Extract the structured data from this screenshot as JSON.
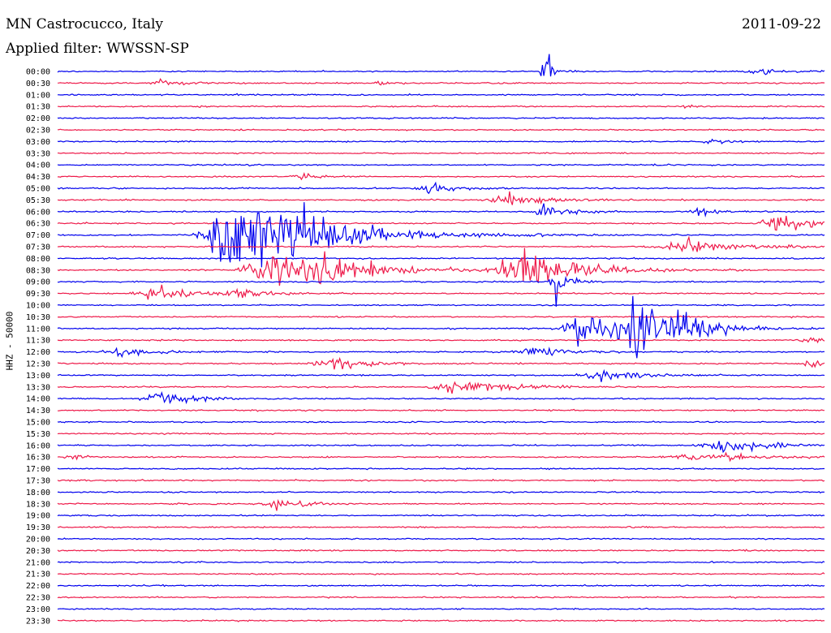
{
  "header": {
    "station": "MN Castrocucco, Italy",
    "date": "2011-09-22",
    "filter": "Applied filter: WWSSN-SP"
  },
  "chart_data": {
    "type": "line",
    "ylabel": "HHZ - 50000",
    "colors": [
      "#0000ee",
      "#ee1a4a"
    ],
    "rows": [
      "00:00",
      "00:30",
      "01:00",
      "01:30",
      "02:00",
      "02:30",
      "03:00",
      "03:30",
      "04:00",
      "04:30",
      "05:00",
      "05:30",
      "06:00",
      "06:30",
      "07:00",
      "07:30",
      "08:00",
      "08:30",
      "09:00",
      "09:30",
      "10:00",
      "10:30",
      "11:00",
      "11:30",
      "12:00",
      "12:30",
      "13:00",
      "13:30",
      "14:00",
      "14:30",
      "15:00",
      "15:30",
      "16:00",
      "16:30",
      "17:00",
      "17:30",
      "18:00",
      "18:30",
      "19:00",
      "19:30",
      "20:00",
      "20:30",
      "21:00",
      "21:30",
      "22:00",
      "22:30",
      "23:00",
      "23:30"
    ],
    "events": [
      {
        "row": 0,
        "minute": 19.0,
        "amplitude": 20,
        "duration": 0.5
      },
      {
        "row": 0,
        "minute": 27.5,
        "amplitude": 3,
        "duration": 2
      },
      {
        "row": 1,
        "minute": 4.0,
        "amplitude": 7,
        "duration": 1
      },
      {
        "row": 1,
        "minute": 12.5,
        "amplitude": 4,
        "duration": 0.6
      },
      {
        "row": 3,
        "minute": 24.5,
        "amplitude": 2,
        "duration": 0.5
      },
      {
        "row": 6,
        "minute": 25.5,
        "amplitude": 3,
        "duration": 0.8
      },
      {
        "row": 9,
        "minute": 9.5,
        "amplitude": 4,
        "duration": 1
      },
      {
        "row": 10,
        "minute": 14.5,
        "amplitude": 7,
        "duration": 1.5
      },
      {
        "row": 11,
        "minute": 17.5,
        "amplitude": 8,
        "duration": 2
      },
      {
        "row": 12,
        "minute": 19.0,
        "amplitude": 7,
        "duration": 1.5
      },
      {
        "row": 12,
        "minute": 25.0,
        "amplitude": 10,
        "duration": 0.8
      },
      {
        "row": 13,
        "minute": 28.0,
        "amplitude": 10,
        "duration": 2
      },
      {
        "row": 14,
        "minute": 6.5,
        "amplitude": 50,
        "duration": 3
      },
      {
        "row": 14,
        "minute": 9.0,
        "amplitude": 20,
        "duration": 5
      },
      {
        "row": 15,
        "minute": 24.5,
        "amplitude": 8,
        "duration": 3
      },
      {
        "row": 17,
        "minute": 8.5,
        "amplitude": 30,
        "duration": 4
      },
      {
        "row": 17,
        "minute": 18.0,
        "amplitude": 30,
        "duration": 3
      },
      {
        "row": 18,
        "minute": 19.5,
        "amplitude": 20,
        "duration": 0.7
      },
      {
        "row": 19,
        "minute": 3.5,
        "amplitude": 10,
        "duration": 2
      },
      {
        "row": 19,
        "minute": 7.0,
        "amplitude": 7,
        "duration": 1.5
      },
      {
        "row": 22,
        "minute": 20.5,
        "amplitude": 18,
        "duration": 3
      },
      {
        "row": 22,
        "minute": 22.5,
        "amplitude": 40,
        "duration": 1.5
      },
      {
        "row": 22,
        "minute": 24.5,
        "amplitude": 14,
        "duration": 2
      },
      {
        "row": 23,
        "minute": 29.3,
        "amplitude": 5,
        "duration": 1
      },
      {
        "row": 24,
        "minute": 2.5,
        "amplitude": 5,
        "duration": 2
      },
      {
        "row": 24,
        "minute": 18.5,
        "amplitude": 6,
        "duration": 2
      },
      {
        "row": 25,
        "minute": 10.5,
        "amplitude": 7,
        "duration": 2.5
      },
      {
        "row": 25,
        "minute": 29.5,
        "amplitude": 8,
        "duration": 0.8
      },
      {
        "row": 26,
        "minute": 21.0,
        "amplitude": 10,
        "duration": 2
      },
      {
        "row": 27,
        "minute": 15.5,
        "amplitude": 12,
        "duration": 2.5
      },
      {
        "row": 28,
        "minute": 4.0,
        "amplitude": 8,
        "duration": 2
      },
      {
        "row": 32,
        "minute": 26.0,
        "amplitude": 8,
        "duration": 3
      },
      {
        "row": 33,
        "minute": 0.5,
        "amplitude": 5,
        "duration": 0.6
      },
      {
        "row": 33,
        "minute": 25.0,
        "amplitude": 4,
        "duration": 4
      },
      {
        "row": 37,
        "minute": 8.5,
        "amplitude": 7,
        "duration": 1.5
      }
    ]
  }
}
